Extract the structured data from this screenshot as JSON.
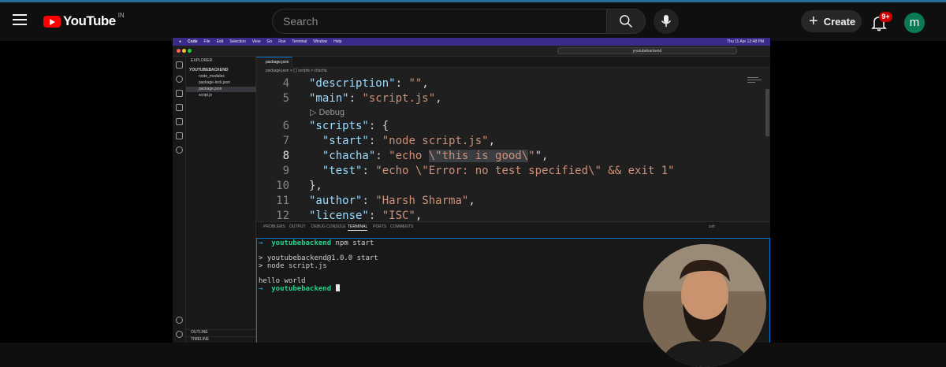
{
  "youtube": {
    "logo_text": "YouTube",
    "region": "IN",
    "search_placeholder": "Search",
    "create_label": "Create",
    "notifications_badge": "9+",
    "avatar_letter": "m",
    "colors": {
      "brand_red": "#ff0000",
      "avatar_bg": "#0b7a54",
      "badge_bg": "#cc0000"
    },
    "icons": [
      "menu-icon",
      "search-icon",
      "mic-icon",
      "plus-icon",
      "bell-icon"
    ]
  },
  "mac_menubar": {
    "items": [
      "Code",
      "File",
      "Edit",
      "Selection",
      "View",
      "Go",
      "Run",
      "Terminal",
      "Window",
      "Help"
    ],
    "clock": "Thu 11 Apr  12:48 PM"
  },
  "vscode": {
    "command_center": "youtubebackend",
    "explorer": {
      "title": "EXPLORER",
      "root": "YOUTUBEBACKEND",
      "items": [
        "node_modules",
        "package-lock.json",
        "package.json",
        "script.js"
      ],
      "selected_index": 2,
      "outline": "OUTLINE",
      "timeline": "TIMELINE"
    },
    "tab": {
      "label": "package.json"
    },
    "breadcrumb": "package.json  >  { } scripts  >  chacha",
    "editor": {
      "codelens": "Debug",
      "active_line": 8,
      "lines": [
        {
          "num": "4",
          "text": "\"description\": \"\","
        },
        {
          "num": "5",
          "text": "\"main\": \"script.js\","
        },
        {
          "num": "6",
          "text": "\"scripts\": {"
        },
        {
          "num": "7",
          "text": "  \"start\": \"node script.js\","
        },
        {
          "num": "8",
          "text": "  \"chacha\": \"echo \\\"this is good\\\"\","
        },
        {
          "num": "9",
          "text": "  \"test\": \"echo \\\"Error: no test specified\\\" && exit 1\""
        },
        {
          "num": "10",
          "text": "},"
        },
        {
          "num": "11",
          "text": "\"author\": \"Harsh Sharma\","
        },
        {
          "num": "12",
          "text": "\"license\": \"ISC\","
        }
      ]
    },
    "panel": {
      "tabs": [
        "PROBLEMS",
        "OUTPUT",
        "DEBUG CONSOLE",
        "TERMINAL",
        "PORTS",
        "COMMENTS"
      ],
      "active_tab_index": 3,
      "shell_label": "zsh",
      "terminal": {
        "prompt_dir": "youtubebackend",
        "command": "npm start",
        "output": [
          "> youtubebackend@1.0.0 start",
          "> node script.js",
          "hello world"
        ]
      }
    }
  }
}
